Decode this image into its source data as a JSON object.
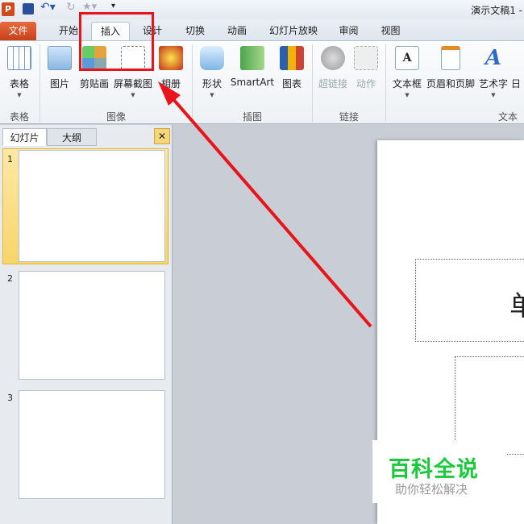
{
  "titlebar": {
    "app_icon": "P",
    "doc_title": "演示文稿1 -",
    "quick_access": [
      "save-icon",
      "undo-icon",
      "redo-icon",
      "star-icon",
      "customize-icon"
    ]
  },
  "tabs": [
    "文件",
    "开始",
    "插入",
    "设计",
    "切换",
    "动画",
    "幻灯片放映",
    "审阅",
    "视图"
  ],
  "ribbon": {
    "groups": [
      {
        "label": "表格",
        "buttons": [
          "表格"
        ]
      },
      {
        "label": "图像",
        "buttons": [
          "图片",
          "剪贴画",
          "屏幕截图",
          "相册"
        ]
      },
      {
        "label": "插图",
        "buttons": [
          "形状",
          "SmartArt",
          "图表"
        ]
      },
      {
        "label": "链接",
        "buttons": [
          "超链接",
          "动作"
        ]
      },
      {
        "label": "文本",
        "buttons": [
          "文本框",
          "页眉和页脚",
          "艺术字",
          "日"
        ]
      }
    ]
  },
  "leftpane": {
    "tabs": [
      "幻灯片",
      "大纲"
    ],
    "close": "✕",
    "slides": [
      "1",
      "2",
      "3"
    ]
  },
  "slide": {
    "title_fragment": "单"
  },
  "watermark": {
    "title": "百科全说",
    "subtitle": "助你轻松解决"
  },
  "colors": {
    "highlight": "#e8141a",
    "file_tab": "#d4502a",
    "watermark_green": "#1bc93a"
  }
}
